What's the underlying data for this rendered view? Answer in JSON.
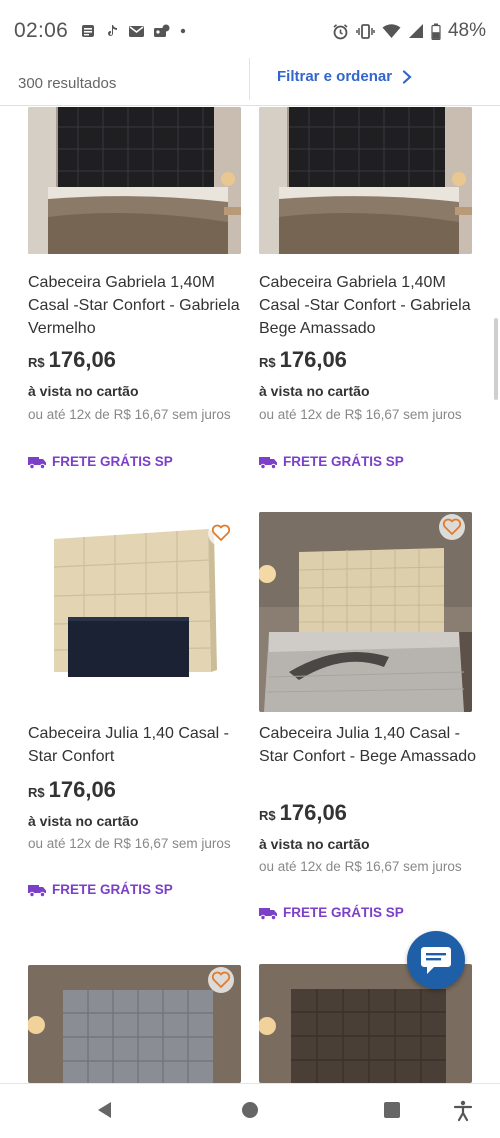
{
  "status_bar": {
    "time": "02:06",
    "battery": "48%",
    "left_icons": [
      "news-icon",
      "tiktok-icon",
      "mail-icon",
      "photos-icon",
      "dot-icon"
    ],
    "right_icons": [
      "alarm-icon",
      "vibrate-icon",
      "wifi-icon",
      "signal-icon",
      "battery-icon"
    ]
  },
  "header": {
    "results": "300 resultados",
    "filter_label": "Filtrar e ordenar"
  },
  "colors": {
    "accent_blue": "#3366cc",
    "shipping_purple": "#7b3fc8",
    "chat_blue": "#1e5fa8",
    "heart_orange": "#e07c2e"
  },
  "products": [
    {
      "title": "Cabeceira Gabriela 1,40M Casal -Star Confort - Gabriela Vermelho",
      "currency": "R$",
      "price": "176,06",
      "cash": "à vista no cartão",
      "installments": "ou até 12x de R$ 16,67 sem juros",
      "shipping": "FRETE GRÁTIS SP",
      "image": "headboard-black-tufted-bedroom"
    },
    {
      "title": "Cabeceira Gabriela 1,40M Casal -Star Confort - Gabriela Bege Amassado",
      "currency": "R$",
      "price": "176,06",
      "cash": "à vista no cartão",
      "installments": "ou até 12x de R$ 16,67 sem juros",
      "shipping": "FRETE GRÁTIS SP",
      "image": "headboard-black-tufted-bedroom"
    },
    {
      "title": "Cabeceira Julia 1,40 Casal - Star Confort",
      "currency": "R$",
      "price": "176,06",
      "cash": "à vista no cartão",
      "installments": "ou até 12x de R$ 16,67 sem juros",
      "shipping": "FRETE GRÁTIS SP",
      "image": "headboard-beige-panel-isolated"
    },
    {
      "title": "Cabeceira Julia 1,40 Casal - Star Confort - Bege Amassado",
      "currency": "R$",
      "price": "176,06",
      "cash": "à vista no cartão",
      "installments": "ou até 12x de R$ 16,67 sem juros",
      "shipping": "FRETE GRÁTIS SP",
      "image": "headboard-beige-bedroom"
    },
    {
      "image": "headboard-gray-bedroom"
    },
    {
      "image": "headboard-brown-bedroom"
    }
  ],
  "nav": {
    "buttons": [
      "back-icon",
      "home-icon",
      "recents-icon",
      "accessibility-icon"
    ]
  }
}
